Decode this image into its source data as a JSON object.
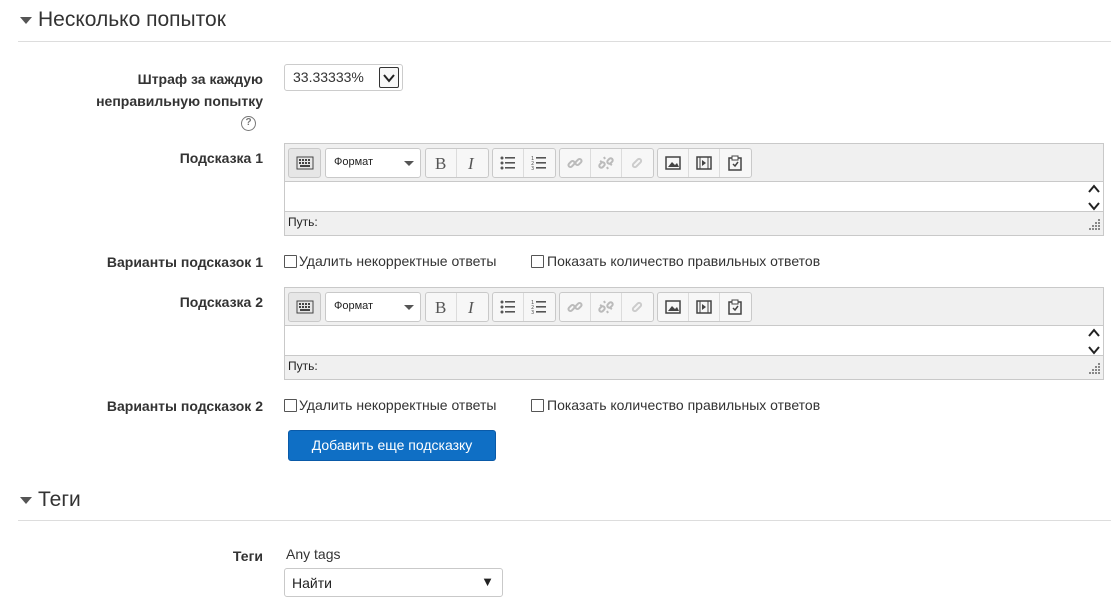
{
  "sections": {
    "attempts": {
      "title": "Несколько попыток"
    },
    "tags": {
      "title": "Теги"
    }
  },
  "penalty": {
    "label": "Штраф за каждую неправильную попытку",
    "label_line1": "Штраф за каждую",
    "label_line2": "неправильную попытку",
    "help_icon": "question-circle-icon",
    "help_glyph": "?",
    "value": "33.33333%"
  },
  "hints": [
    {
      "label": "Подсказка 1",
      "format_label": "Формат",
      "path_label": "Путь:",
      "options_label": "Варианты подсказок 1",
      "option_remove": "Удалить некорректные ответы",
      "option_show": "Показать количество правильных ответов"
    },
    {
      "label": "Подсказка 2",
      "format_label": "Формат",
      "path_label": "Путь:",
      "options_label": "Варианты подсказок 2",
      "option_remove": "Удалить некорректные ответы",
      "option_show": "Показать количество правильных ответов"
    }
  ],
  "toolbar_icons": [
    "toolbar-toggle-icon",
    "bold-icon",
    "italic-icon",
    "unordered-list-icon",
    "ordered-list-icon",
    "link-icon",
    "unlink-icon",
    "anchor-icon",
    "image-icon",
    "media-icon",
    "paste-icon"
  ],
  "add_hint_button": "Добавить еще подсказку",
  "tags": {
    "label": "Теги",
    "any_tags": "Any tags",
    "select_value": "Найти",
    "caret": "▼"
  },
  "colors": {
    "primary": "#0f6fc5",
    "text": "#333333",
    "border": "#c9c9c9",
    "editor_bg": "#f0f0f0"
  }
}
